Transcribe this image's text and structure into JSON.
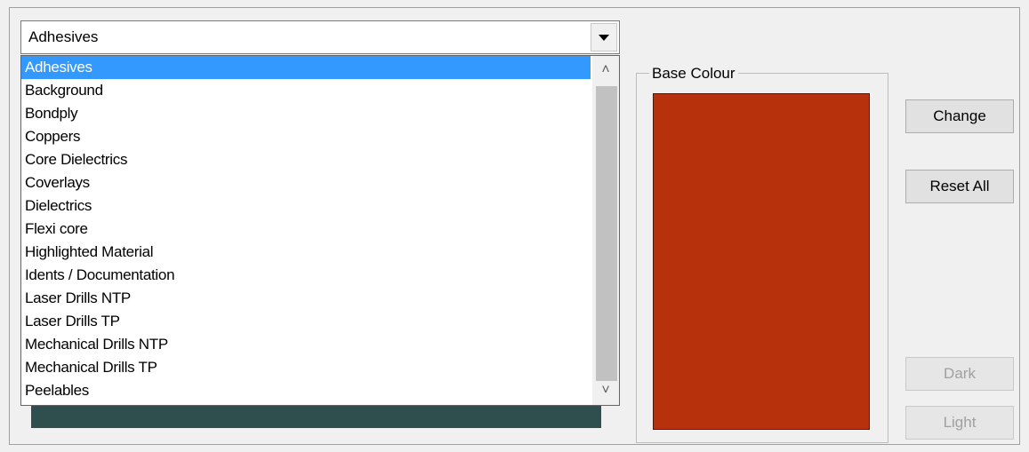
{
  "combo": {
    "value": "Adhesives"
  },
  "list": {
    "items": [
      "Adhesives",
      "Background",
      "Bondply",
      "Coppers",
      "Core Dielectrics",
      "Coverlays",
      "Dielectrics",
      "Flexi core",
      "Highlighted Material",
      "Idents / Documentation",
      "Laser Drills NTP",
      "Laser Drills TP",
      "Mechanical Drills NTP",
      "Mechanical Drills TP",
      "Peelables"
    ],
    "selected_index": 0
  },
  "base_colour": {
    "label": "Base Colour",
    "color": "#b8310d"
  },
  "buttons": {
    "change": "Change",
    "reset_all": "Reset All",
    "dark": "Dark",
    "light": "Light"
  },
  "colors": {
    "selection": "#3399ff",
    "hidden_bar": "#2f4f4f"
  },
  "icons": {
    "combo_arrow": "chevron-down-icon",
    "scroll_up": "scroll-up-icon",
    "scroll_down": "scroll-down-icon"
  }
}
